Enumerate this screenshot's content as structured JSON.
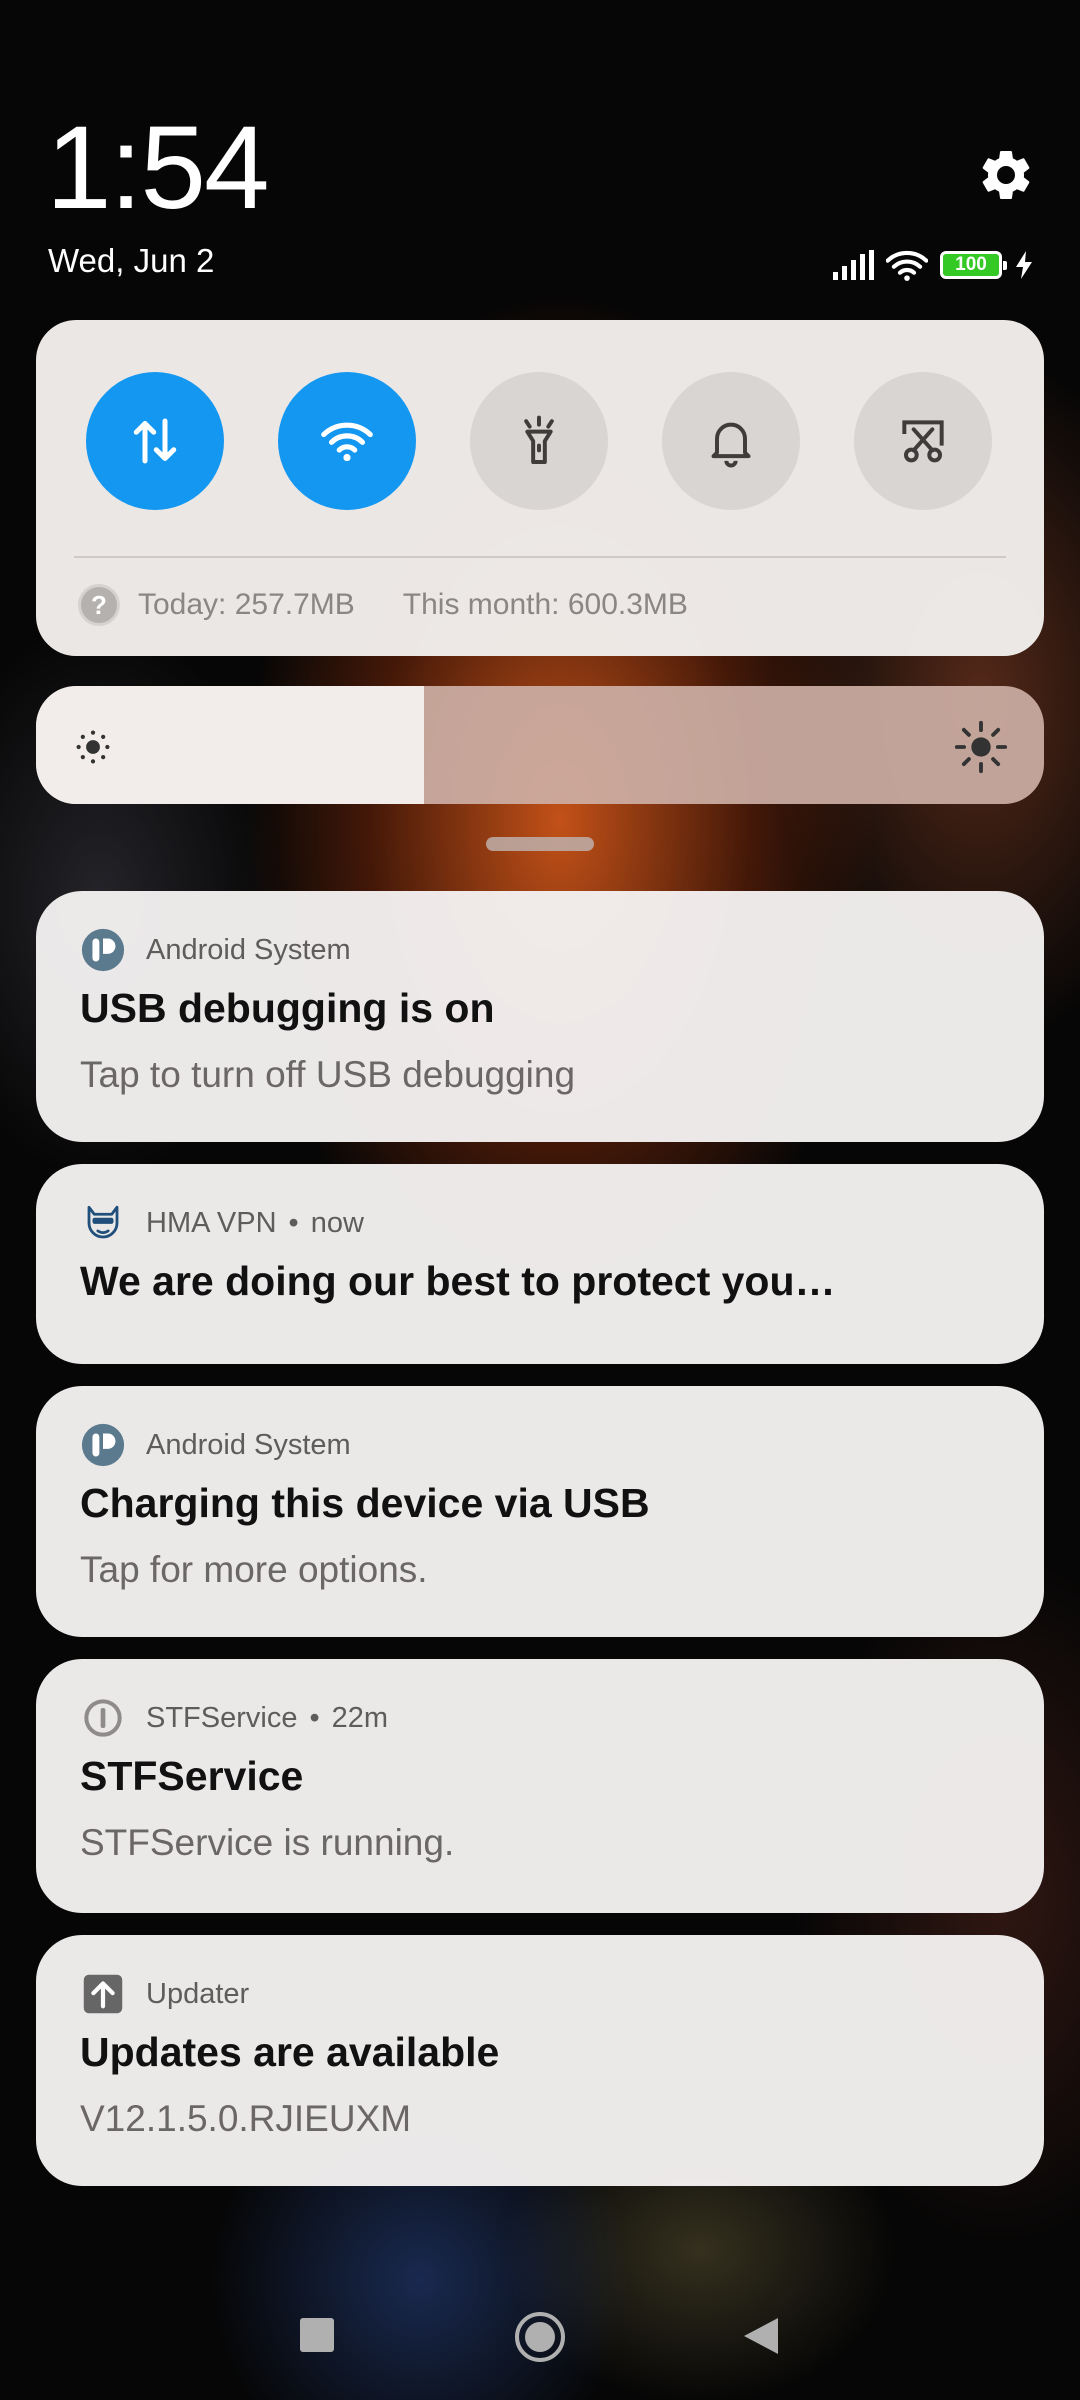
{
  "status_bar": {
    "time": "1:54",
    "date": "Wed, Jun 2",
    "battery": "100",
    "icons": [
      "signal-icon",
      "wifi-icon",
      "battery-icon",
      "charging-icon"
    ]
  },
  "quick_settings": {
    "toggles": [
      {
        "name": "mobile-data-toggle",
        "icon": "data-transfer-icon",
        "state": "on"
      },
      {
        "name": "wifi-toggle",
        "icon": "wifi-icon",
        "state": "on"
      },
      {
        "name": "flashlight-toggle",
        "icon": "flashlight-icon",
        "state": "off"
      },
      {
        "name": "sound-toggle",
        "icon": "bell-icon",
        "state": "off"
      },
      {
        "name": "screenshot-toggle",
        "icon": "scissors-icon",
        "state": "off"
      }
    ],
    "usage_today": "Today: 257.7MB",
    "usage_month": "This month: 600.3MB"
  },
  "brightness": {
    "level": 0.385
  },
  "notifications": [
    {
      "app": "Android System",
      "time": "",
      "title": "USB debugging is on",
      "text": "Tap to turn off USB debugging",
      "icon": "android-system-icon"
    },
    {
      "app": "HMA VPN",
      "time": "now",
      "title": "We are doing our best to protect you…",
      "text": "",
      "icon": "hma-vpn-icon"
    },
    {
      "app": "Android System",
      "time": "",
      "title": "Charging this device via USB",
      "text": "Tap for more options.",
      "icon": "android-system-icon"
    },
    {
      "app": "STFService",
      "time": "22m",
      "title": "STFService",
      "text": "STFService is running.",
      "icon": "info-icon"
    },
    {
      "app": "Updater",
      "time": "",
      "title": "Updates are available",
      "text": "V12.1.5.0.RJIEUXM",
      "icon": "updater-icon"
    }
  ],
  "colors": {
    "accent": "#1397f1",
    "battery": "#34c924"
  }
}
